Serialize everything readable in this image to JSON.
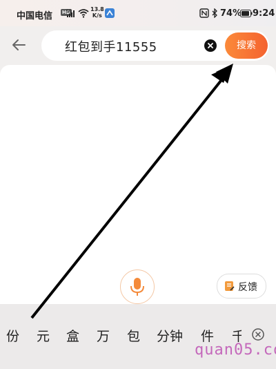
{
  "status_bar": {
    "carrier": "中国电信",
    "hd_badge": "HD",
    "network": "5G",
    "speed_value": "13.8",
    "speed_unit": "K/s",
    "battery_percent": "74%",
    "time": "9:24",
    "icons": [
      "nfc-icon",
      "bluetooth-icon",
      "battery-icon",
      "wifi-icon",
      "signal-icon"
    ]
  },
  "search": {
    "query": "红包到手11555",
    "search_button_label": "搜索",
    "accent_color": "#f4622f"
  },
  "actions": {
    "feedback_label": "反馈"
  },
  "candidates": {
    "items": [
      "份",
      "元",
      "盒",
      "万",
      "包",
      "分钟",
      "件",
      "千"
    ]
  },
  "watermark": {
    "text": "quan05.com"
  }
}
